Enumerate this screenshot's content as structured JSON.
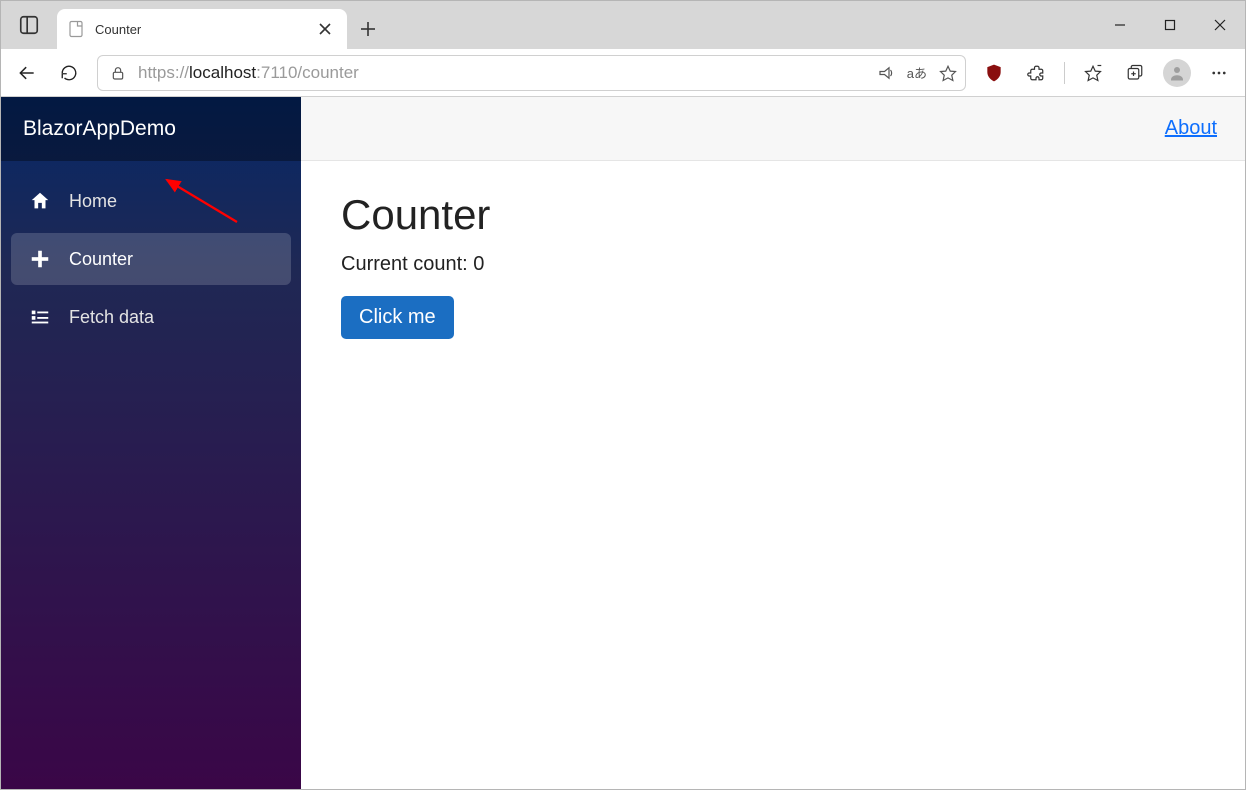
{
  "browser": {
    "tab_title": "Counter",
    "url_protocol": "https://",
    "url_host_main": "localhost",
    "url_rest": ":7110/counter"
  },
  "app": {
    "brand": "BlazorAppDemo",
    "about_label": "About",
    "nav": [
      {
        "label": "Home",
        "icon": "home-icon",
        "active": false
      },
      {
        "label": "Counter",
        "icon": "plus-icon",
        "active": true
      },
      {
        "label": "Fetch data",
        "icon": "list-icon",
        "active": false
      }
    ],
    "page": {
      "heading": "Counter",
      "count_label": "Current count: ",
      "count_value": "0",
      "button_label": "Click me"
    }
  }
}
